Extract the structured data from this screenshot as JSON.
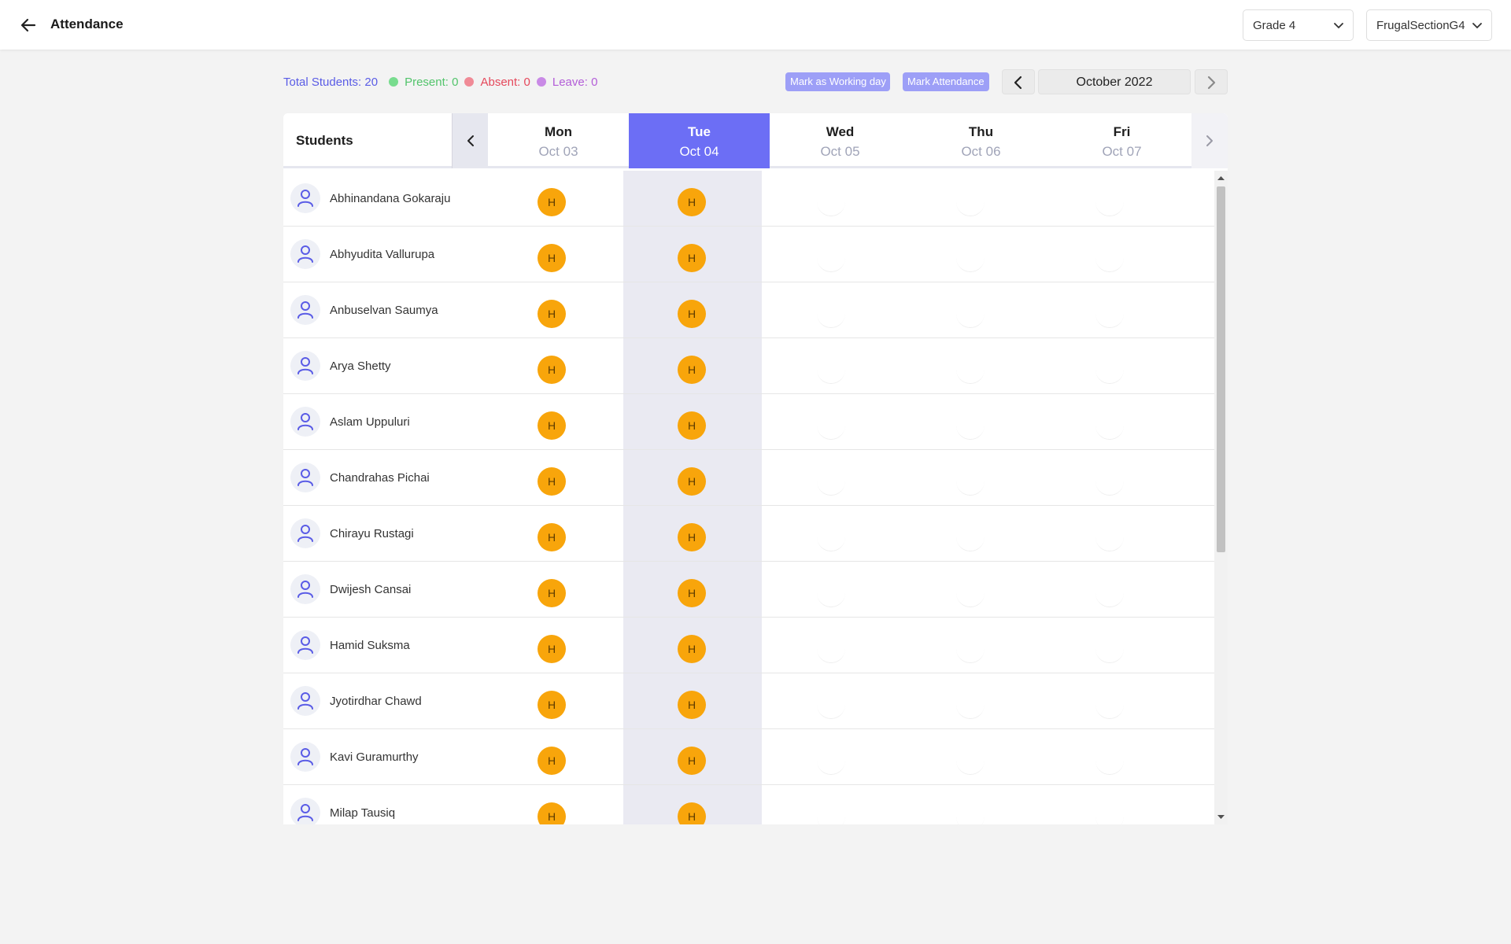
{
  "header": {
    "title": "Attendance",
    "grade": "Grade 4",
    "section": "FrugalSectionG4"
  },
  "summary": {
    "total": "Total Students: 20",
    "present": "Present: 0",
    "absent": "Absent: 0",
    "leave": "Leave: 0",
    "colors": {
      "present": "#52c46b",
      "absent": "#e5485b",
      "leave": "#b35dd8"
    }
  },
  "actions": {
    "mark_working": "Mark as Working day",
    "mark_attendance": "Mark Attendance"
  },
  "month": "October 2022",
  "table": {
    "students_header": "Students",
    "days": [
      {
        "name": "Mon",
        "date": "Oct 03",
        "active": false
      },
      {
        "name": "Tue",
        "date": "Oct 04",
        "active": true
      },
      {
        "name": "Wed",
        "date": "Oct 05",
        "active": false
      },
      {
        "name": "Thu",
        "date": "Oct 06",
        "active": false
      },
      {
        "name": "Fri",
        "date": "Oct 07",
        "active": false
      }
    ],
    "students": [
      {
        "name": "Abhinandana Gokaraju",
        "marks": [
          "H",
          "H",
          "",
          "",
          ""
        ]
      },
      {
        "name": "Abhyudita Vallurupa",
        "marks": [
          "H",
          "H",
          "",
          "",
          ""
        ]
      },
      {
        "name": "Anbuselvan Saumya",
        "marks": [
          "H",
          "H",
          "",
          "",
          ""
        ]
      },
      {
        "name": "Arya Shetty",
        "marks": [
          "H",
          "H",
          "",
          "",
          ""
        ]
      },
      {
        "name": "Aslam Uppuluri",
        "marks": [
          "H",
          "H",
          "",
          "",
          ""
        ]
      },
      {
        "name": "Chandrahas Pichai",
        "marks": [
          "H",
          "H",
          "",
          "",
          ""
        ]
      },
      {
        "name": "Chirayu Rustagi",
        "marks": [
          "H",
          "H",
          "",
          "",
          ""
        ]
      },
      {
        "name": "Dwijesh Cansai",
        "marks": [
          "H",
          "H",
          "",
          "",
          ""
        ]
      },
      {
        "name": "Hamid Suksma",
        "marks": [
          "H",
          "H",
          "",
          "",
          ""
        ]
      },
      {
        "name": "Jyotirdhar Chawd",
        "marks": [
          "H",
          "H",
          "",
          "",
          ""
        ]
      },
      {
        "name": "Kavi Guramurthy",
        "marks": [
          "H",
          "H",
          "",
          "",
          ""
        ]
      },
      {
        "name": "Milap Tausiq",
        "marks": [
          "H",
          "H",
          "",
          "",
          ""
        ]
      }
    ],
    "badge_color": "#f8a50b",
    "active_color": "#6c6ef5"
  },
  "icons": {
    "back": "arrow-left-icon",
    "dropdown": "chevron-down-icon",
    "prev": "chevron-left-icon",
    "next": "chevron-right-icon",
    "avatar": "user-icon"
  }
}
